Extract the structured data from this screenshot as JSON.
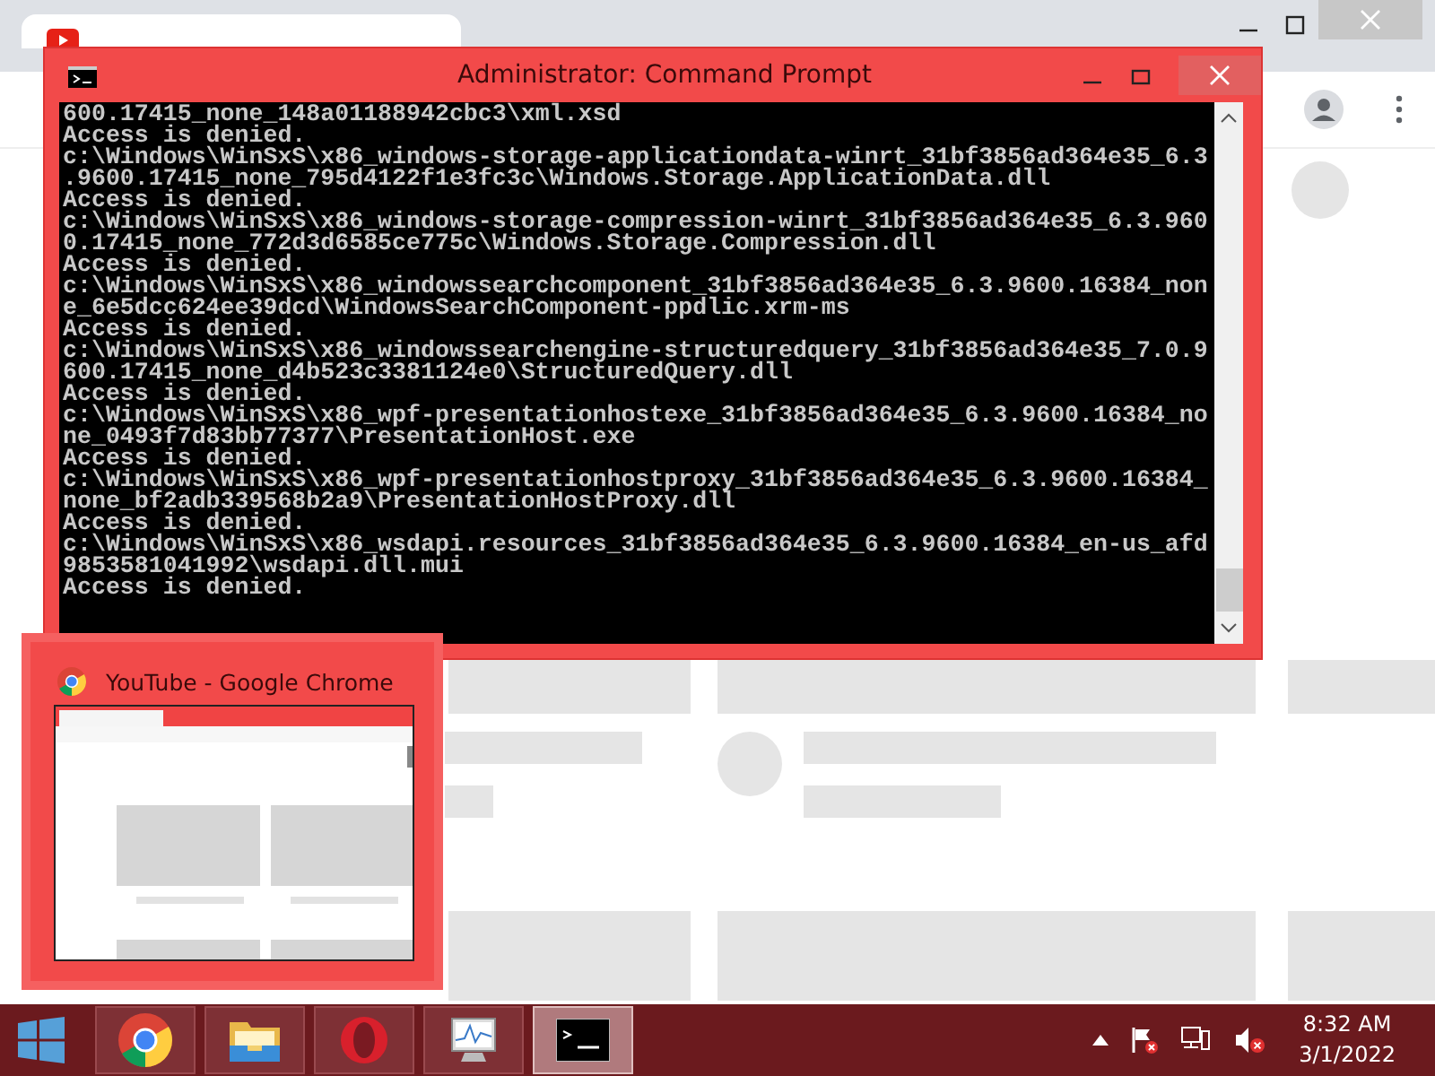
{
  "console_window": {
    "title": "Administrator: Command Prompt",
    "lines": [
      "600.17415_none_148a01188942cbc3\\xml.xsd",
      "Access is denied.",
      "c:\\Windows\\WinSxS\\x86_windows-storage-applicationdata-winrt_31bf3856ad364e35_6.3",
      ".9600.17415_none_795d4122f1e3fc3c\\Windows.Storage.ApplicationData.dll",
      "Access is denied.",
      "c:\\Windows\\WinSxS\\x86_windows-storage-compression-winrt_31bf3856ad364e35_6.3.960",
      "0.17415_none_772d3d6585ce775c\\Windows.Storage.Compression.dll",
      "Access is denied.",
      "c:\\Windows\\WinSxS\\x86_windowssearchcomponent_31bf3856ad364e35_6.3.9600.16384_non",
      "e_6e5dcc624ee39dcd\\WindowsSearchComponent-ppdlic.xrm-ms",
      "Access is denied.",
      "c:\\Windows\\WinSxS\\x86_windowssearchengine-structuredquery_31bf3856ad364e35_7.0.9",
      "600.17415_none_d4b523c3381124e0\\StructuredQuery.dll",
      "Access is denied.",
      "c:\\Windows\\WinSxS\\x86_wpf-presentationhostexe_31bf3856ad364e35_6.3.9600.16384_no",
      "ne_0493f7d83bb77377\\PresentationHost.exe",
      "Access is denied.",
      "c:\\Windows\\WinSxS\\x86_wpf-presentationhostproxy_31bf3856ad364e35_6.3.9600.16384_",
      "none_bf2adb339568b2a9\\PresentationHostProxy.dll",
      "Access is denied.",
      "c:\\Windows\\WinSxS\\x86_wsdapi.resources_31bf3856ad364e35_6.3.9600.16384_en-us_afd",
      "9853581041992\\wsdapi.dll.mui",
      "Access is denied."
    ]
  },
  "switcher": {
    "title": "YouTube - Google Chrome"
  },
  "taskbar": {
    "apps": [
      {
        "kind": "chrome",
        "active": false
      },
      {
        "kind": "explorer",
        "active": false
      },
      {
        "kind": "opera",
        "active": false
      },
      {
        "kind": "monitor",
        "active": false
      },
      {
        "kind": "console",
        "active": true
      }
    ],
    "clock": {
      "time": "8:32 AM",
      "date": "3/1/2022"
    }
  }
}
